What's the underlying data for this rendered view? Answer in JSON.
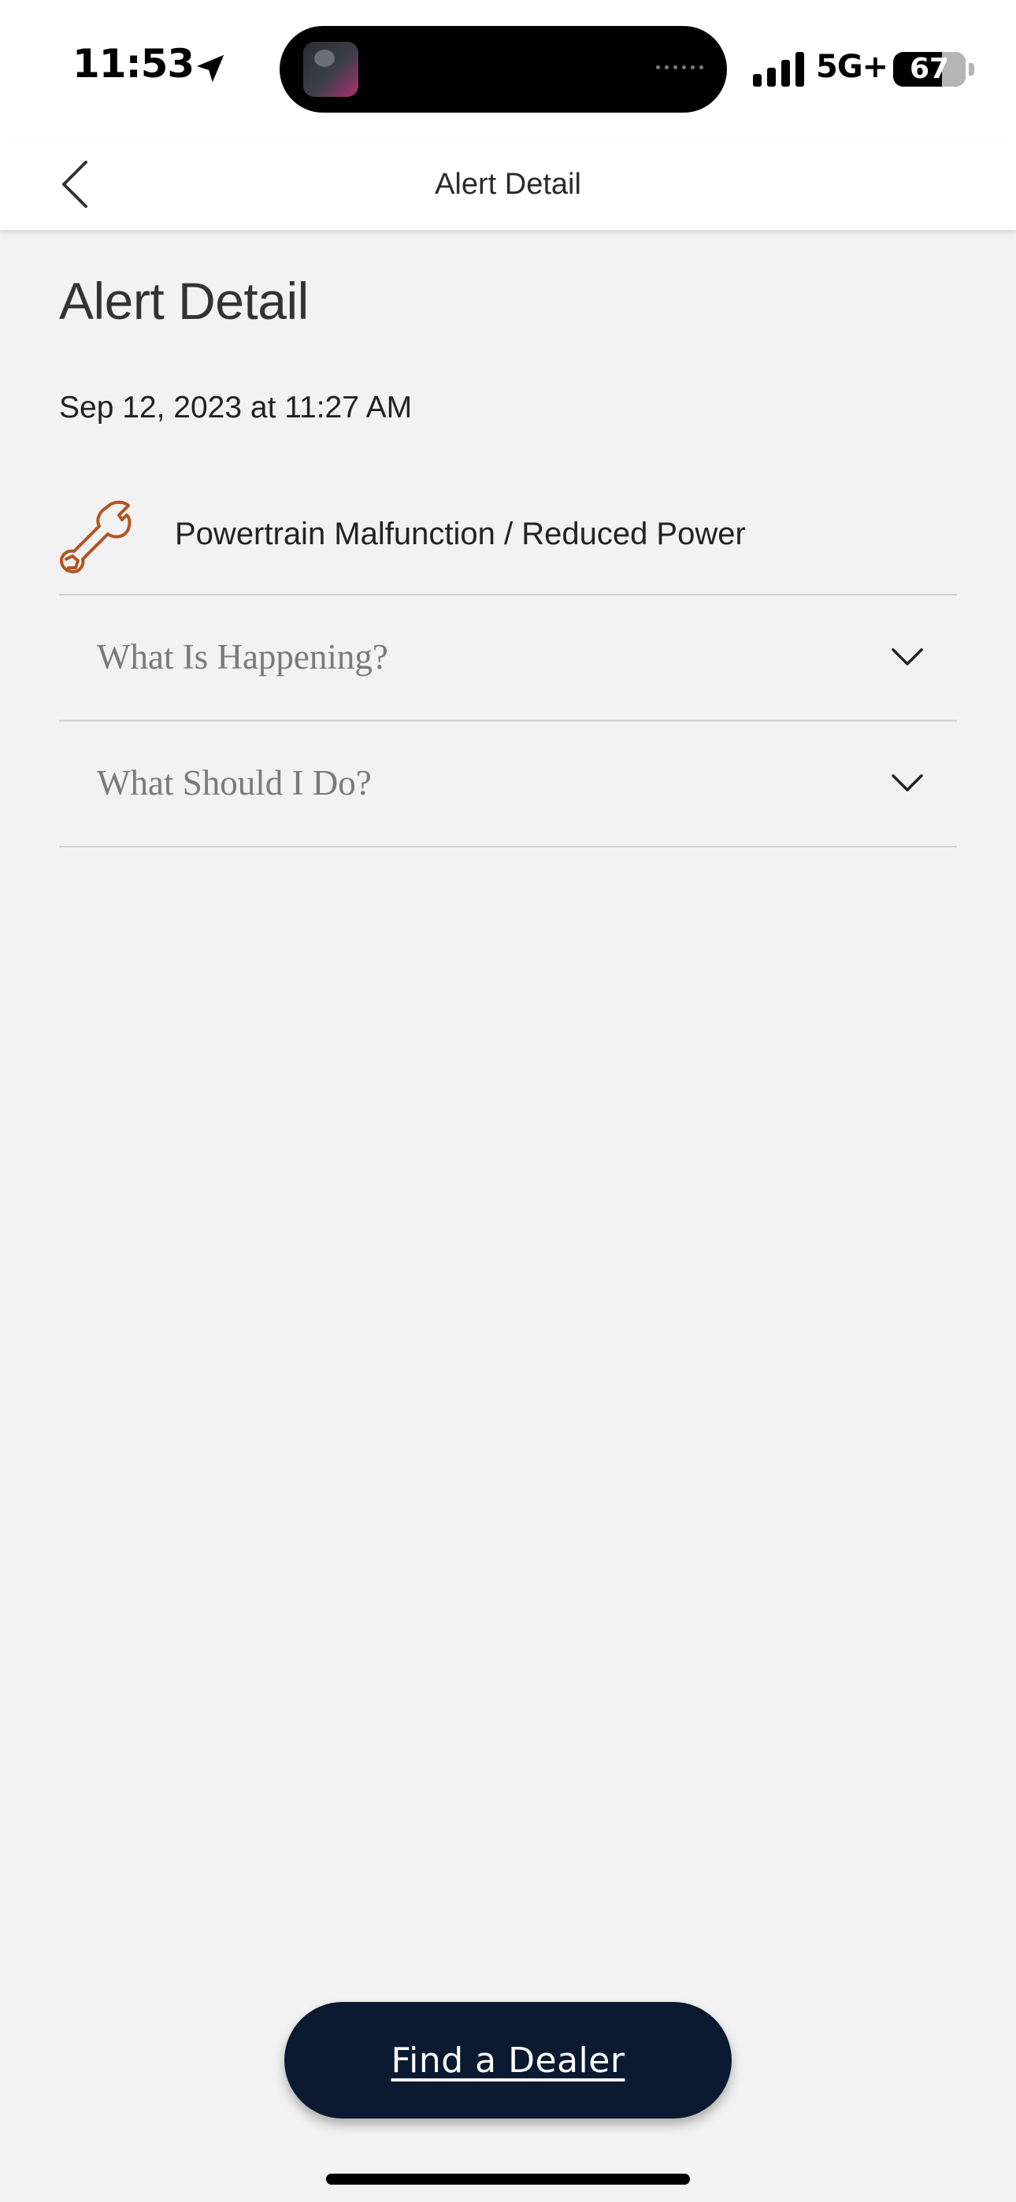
{
  "status_bar": {
    "time": "11:53",
    "network": "5G+",
    "battery_level": "67",
    "icons": [
      "location-arrow-icon",
      "signal-bars-icon",
      "battery-icon"
    ]
  },
  "nav": {
    "title": "Alert Detail",
    "back_icon": "chevron-left-icon"
  },
  "page": {
    "title": "Alert Detail",
    "date": "Sep 12, 2023 at 11:27 AM"
  },
  "alert": {
    "name": "Powertrain Malfunction / Reduced Power",
    "icon": "wrench-icon",
    "icon_color": "#b5531f"
  },
  "sections": [
    {
      "label": "What Is Happening?",
      "expanded": false
    },
    {
      "label": "What Should I Do?",
      "expanded": false
    }
  ],
  "actions": {
    "find_dealer": "Find a Dealer",
    "button_color": "#0b1a30"
  }
}
